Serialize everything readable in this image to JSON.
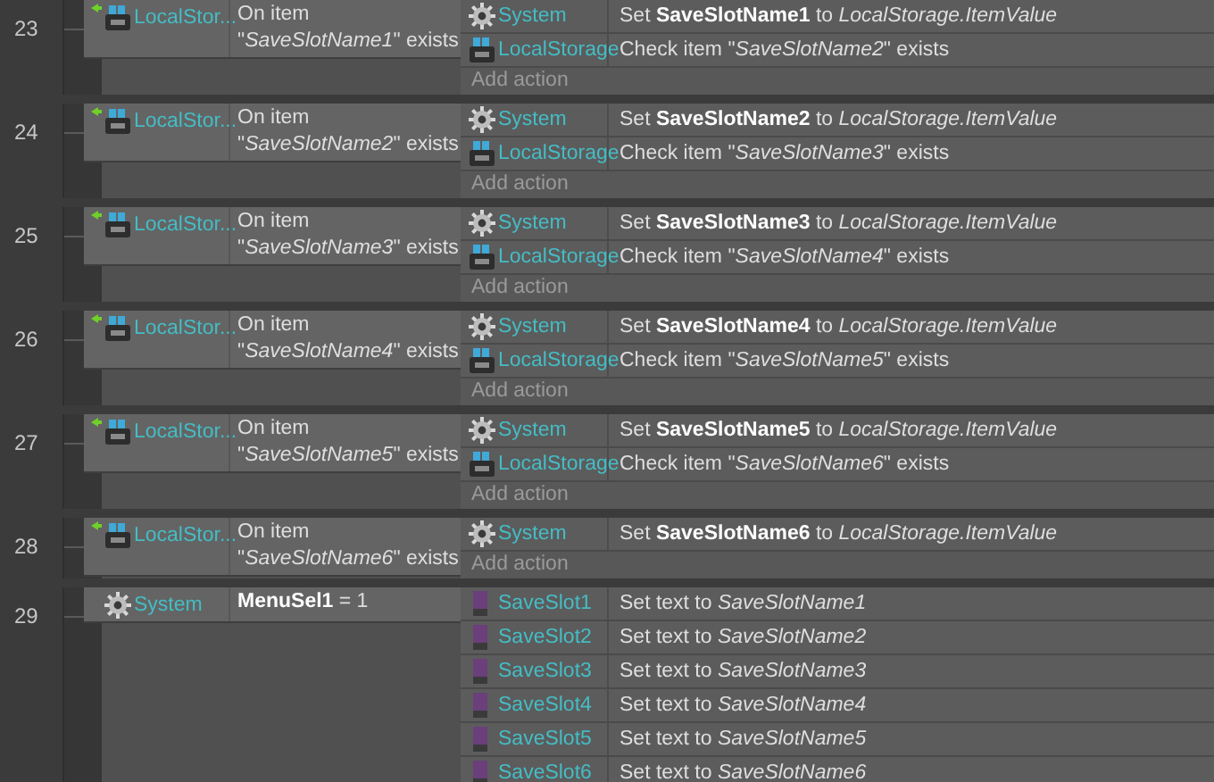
{
  "events": [
    {
      "number": "23",
      "conditions": [
        {
          "kind": "storage",
          "trigger": true,
          "object": "LocalStor...",
          "text": "On item\n\"*SaveSlotName1*\" exists"
        }
      ],
      "actions": [
        {
          "kind": "system",
          "object": "System",
          "text": "Set **SaveSlotName1** to *LocalStorage.ItemValue*"
        },
        {
          "kind": "storage",
          "object": "LocalStorage",
          "text": "Check item \"*SaveSlotName2*\" exists"
        }
      ],
      "add_action": "Add action"
    },
    {
      "number": "24",
      "conditions": [
        {
          "kind": "storage",
          "trigger": true,
          "object": "LocalStor...",
          "text": "On item\n\"*SaveSlotName2*\" exists"
        }
      ],
      "actions": [
        {
          "kind": "system",
          "object": "System",
          "text": "Set **SaveSlotName2** to *LocalStorage.ItemValue*"
        },
        {
          "kind": "storage",
          "object": "LocalStorage",
          "text": "Check item \"*SaveSlotName3*\" exists"
        }
      ],
      "add_action": "Add action"
    },
    {
      "number": "25",
      "conditions": [
        {
          "kind": "storage",
          "trigger": true,
          "object": "LocalStor...",
          "text": "On item\n\"*SaveSlotName3*\" exists"
        }
      ],
      "actions": [
        {
          "kind": "system",
          "object": "System",
          "text": "Set **SaveSlotName3** to *LocalStorage.ItemValue*"
        },
        {
          "kind": "storage",
          "object": "LocalStorage",
          "text": "Check item \"*SaveSlotName4*\" exists"
        }
      ],
      "add_action": "Add action"
    },
    {
      "number": "26",
      "conditions": [
        {
          "kind": "storage",
          "trigger": true,
          "object": "LocalStor...",
          "text": "On item\n\"*SaveSlotName4*\" exists"
        }
      ],
      "actions": [
        {
          "kind": "system",
          "object": "System",
          "text": "Set **SaveSlotName4** to *LocalStorage.ItemValue*"
        },
        {
          "kind": "storage",
          "object": "LocalStorage",
          "text": "Check item \"*SaveSlotName5*\" exists"
        }
      ],
      "add_action": "Add action"
    },
    {
      "number": "27",
      "conditions": [
        {
          "kind": "storage",
          "trigger": true,
          "object": "LocalStor...",
          "text": "On item\n\"*SaveSlotName5*\" exists"
        }
      ],
      "actions": [
        {
          "kind": "system",
          "object": "System",
          "text": "Set **SaveSlotName5** to *LocalStorage.ItemValue*"
        },
        {
          "kind": "storage",
          "object": "LocalStorage",
          "text": "Check item \"*SaveSlotName6*\" exists"
        }
      ],
      "add_action": "Add action"
    },
    {
      "number": "28",
      "conditions": [
        {
          "kind": "storage",
          "trigger": true,
          "object": "LocalStor...",
          "text": "On item\n\"*SaveSlotName6*\" exists"
        }
      ],
      "actions": [
        {
          "kind": "system",
          "object": "System",
          "text": "Set **SaveSlotName6** to *LocalStorage.ItemValue*"
        }
      ],
      "add_action": "Add action"
    },
    {
      "number": "29",
      "conditions": [
        {
          "kind": "system",
          "trigger": false,
          "object": "System",
          "text": "**MenuSel1** = 1"
        }
      ],
      "actions": [
        {
          "kind": "text",
          "object": "SaveSlot1",
          "text": "Set text to *SaveSlotName1*"
        },
        {
          "kind": "text",
          "object": "SaveSlot2",
          "text": "Set text to *SaveSlotName2*"
        },
        {
          "kind": "text",
          "object": "SaveSlot3",
          "text": "Set text to *SaveSlotName3*"
        },
        {
          "kind": "text",
          "object": "SaveSlot4",
          "text": "Set text to *SaveSlotName4*"
        },
        {
          "kind": "text",
          "object": "SaveSlot5",
          "text": "Set text to *SaveSlotName5*"
        },
        {
          "kind": "text",
          "object": "SaveSlot6",
          "text": "Set text to *SaveSlotName6*"
        }
      ]
    }
  ]
}
